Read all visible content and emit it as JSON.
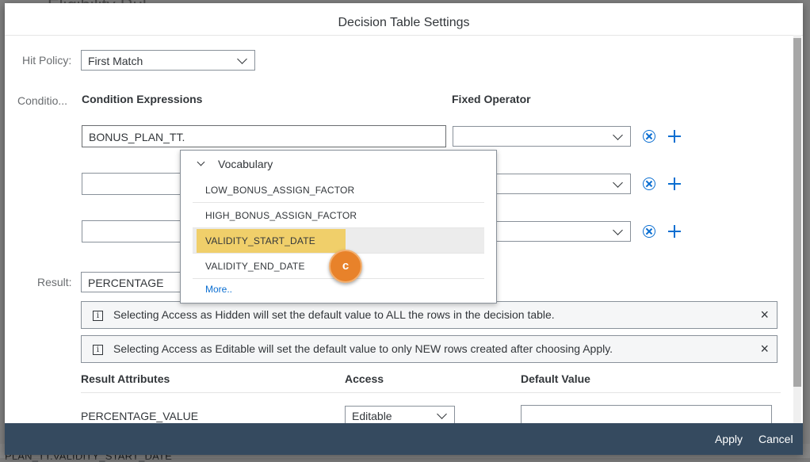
{
  "background": {
    "title_fragment": "Eligibility Rul",
    "bottom_row_text": "PLAN_TT.VALIDITY_START_DATE"
  },
  "dialog": {
    "title": "Decision Table Settings",
    "hit_policy": {
      "label": "Hit Policy:",
      "value": "First Match"
    },
    "conditions": {
      "label": "Conditio...",
      "col_expressions": "Condition Expressions",
      "col_operator": "Fixed Operator",
      "rows": [
        {
          "expression": "BONUS_PLAN_TT.",
          "operator": ""
        },
        {
          "expression": "",
          "operator": ""
        },
        {
          "expression": "",
          "operator": ""
        }
      ]
    },
    "result": {
      "label": "Result:",
      "value": "PERCENTAGE"
    },
    "messages": [
      "Selecting Access as Hidden will set the default value to ALL the rows in the decision table.",
      "Selecting Access as Editable will set the default value to only NEW rows created after choosing Apply."
    ],
    "result_table": {
      "headers": [
        "Result Attributes",
        "Access",
        "Default Value"
      ],
      "rows": [
        {
          "attribute": "PERCENTAGE_VALUE",
          "access": "Editable",
          "default": ""
        }
      ]
    },
    "footer": {
      "apply": "Apply",
      "cancel": "Cancel"
    }
  },
  "suggestions": {
    "group": "Vocabulary",
    "items": [
      "LOW_BONUS_ASSIGN_FACTOR",
      "HIGH_BONUS_ASSIGN_FACTOR",
      "VALIDITY_START_DATE",
      "VALIDITY_END_DATE"
    ],
    "highlighted_index": 2,
    "more": "More.."
  },
  "step_badge": "c",
  "colors": {
    "accent": "#0a6ed1",
    "footer": "#354a5f",
    "highlight": "#f0cf6a",
    "badge": "#e8822a"
  }
}
